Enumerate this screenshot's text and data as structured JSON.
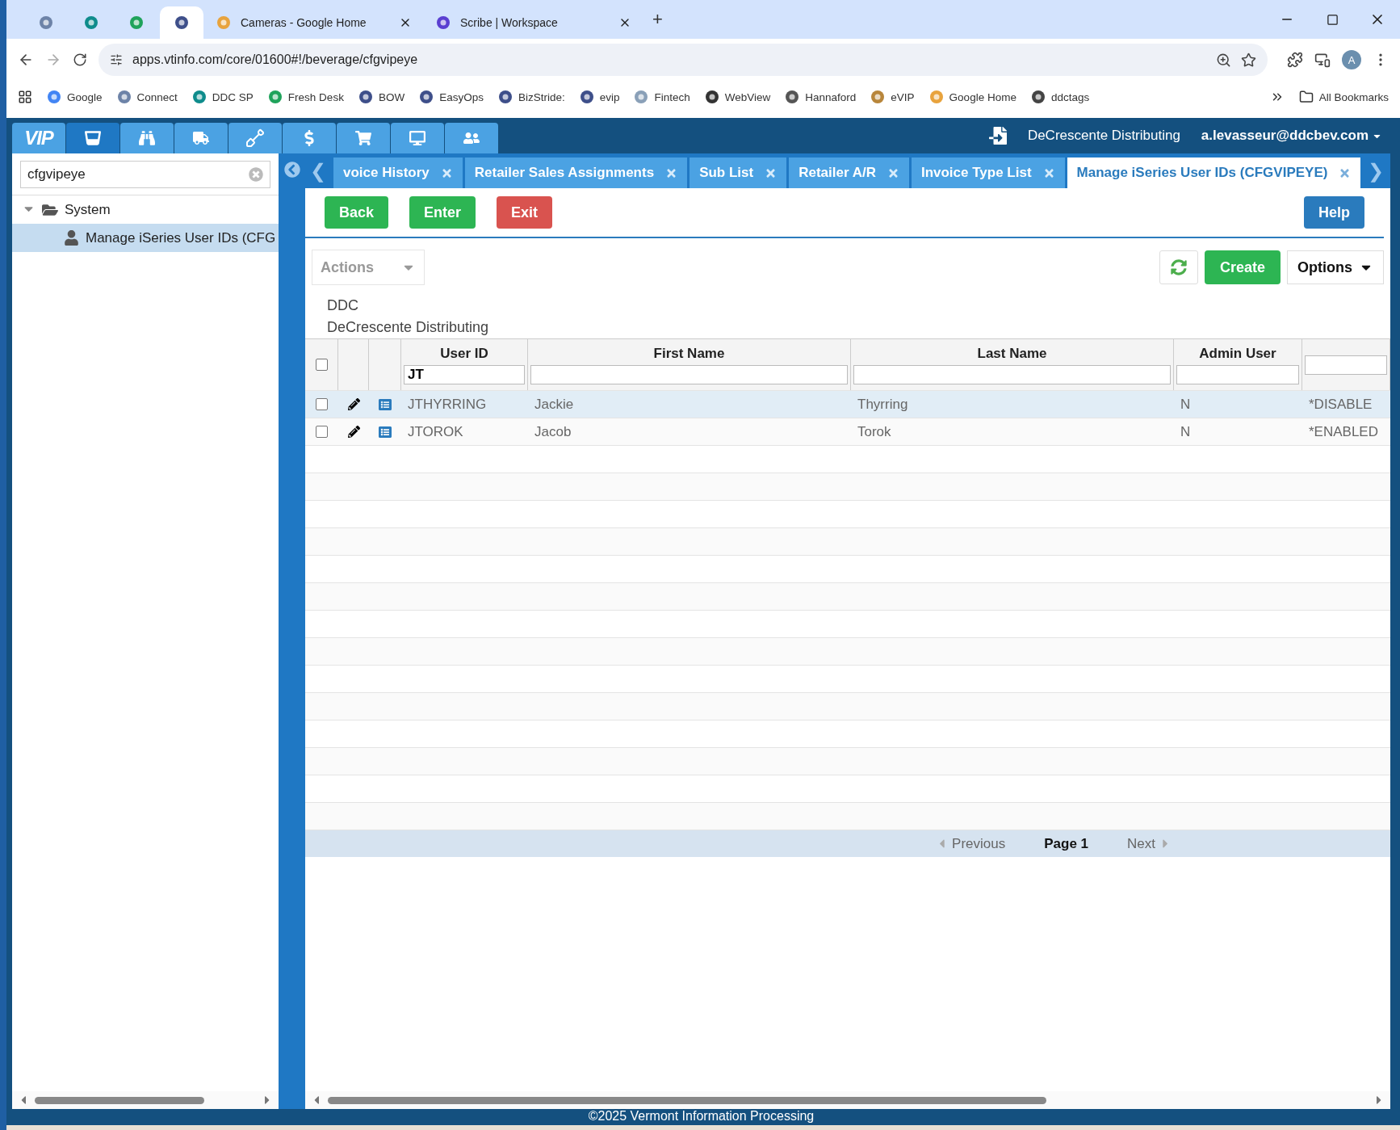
{
  "browser": {
    "tabs": [
      {
        "selected": false
      },
      {
        "selected": false
      },
      {
        "selected": false
      },
      {
        "selected": true
      },
      {
        "title": "Cameras - Google Home",
        "selected": false
      },
      {
        "title": "Scribe | Workspace",
        "selected": false
      }
    ],
    "new_tab": "+",
    "url": "apps.vtinfo.com/core/01600#!/beverage/cfgvipeye",
    "profile": "A",
    "bookmarks": [
      "Google",
      "Connect",
      "DDC SP",
      "Fresh Desk",
      "BOW",
      "EasyOps",
      "BizStride:",
      "evip",
      "Fintech",
      "WebView",
      "Hannaford",
      "eVIP",
      "Google Home",
      "ddctags"
    ],
    "all_bookmarks": "All Bookmarks"
  },
  "app": {
    "logo": "VIP",
    "nav": [
      {
        "selected": true
      },
      {
        "selected": false
      },
      {
        "selected": false
      },
      {
        "selected": false
      },
      {
        "selected": false
      },
      {
        "selected": false
      },
      {
        "selected": false
      },
      {
        "selected": false
      }
    ],
    "company": "DeCrescente Distributing",
    "user": "a.levasseur@ddcbev.com"
  },
  "sidebar": {
    "search": "cfgvipeye",
    "tree": [
      {
        "label": "System",
        "expanded": true,
        "children": [
          {
            "label": "Manage iSeries User IDs (CFG",
            "selected": true
          }
        ]
      }
    ]
  },
  "tab_scroll_left": "❮",
  "tab_scroll_right": "❯",
  "tabs": [
    {
      "label": "voice History",
      "selected": false
    },
    {
      "label": "Retailer Sales Assignments",
      "selected": false
    },
    {
      "label": "Sub List",
      "selected": false
    },
    {
      "label": "Retailer A/R",
      "selected": false
    },
    {
      "label": "Invoice Type List",
      "selected": false
    },
    {
      "label": "Manage iSeries User IDs (CFGVIPEYE)",
      "selected": true
    }
  ],
  "buttons": [
    {
      "label": "Back",
      "kind": "success"
    },
    {
      "label": "Enter",
      "kind": "success"
    },
    {
      "label": "Exit",
      "kind": "danger"
    }
  ],
  "help": "Help",
  "toolbar": {
    "actions": "Actions",
    "create": "Create",
    "options": "Options"
  },
  "company_code": "DDC",
  "company_name": "DeCrescente Distributing",
  "table": {
    "select_all": false,
    "columns": [
      {
        "label": "User ID",
        "filter": "JT"
      },
      {
        "label": "First Name"
      },
      {
        "label": "Last Name"
      },
      {
        "label": "Admin User"
      },
      {}
    ],
    "rows": [
      {
        "checked": false,
        "selected": true,
        "cells": [
          "JTHYRRING",
          "Jackie",
          "Thyrring",
          "N",
          "*DISABLE"
        ]
      },
      {
        "checked": false,
        "selected": false,
        "cells": [
          "JTOROK",
          "Jacob",
          "Torok",
          "N",
          "*ENABLED"
        ]
      }
    ]
  },
  "pager": {
    "previous": "Previous",
    "page": "Page 1",
    "next": "Next"
  },
  "footer": "©2025 Vermont Information Processing"
}
